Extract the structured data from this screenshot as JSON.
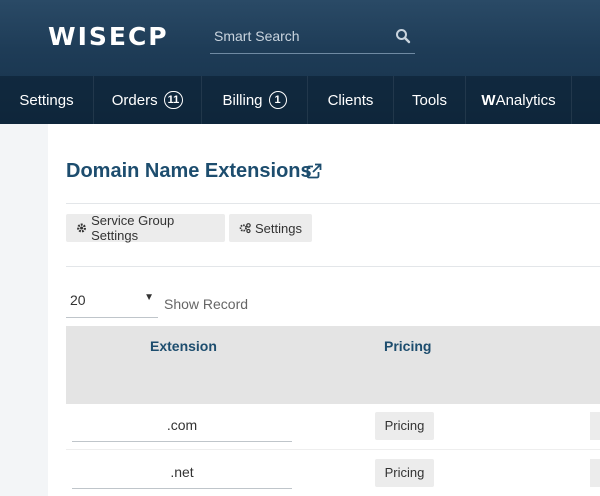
{
  "header": {
    "logo": "WISECP",
    "search": {
      "placeholder": "Smart Search",
      "value": ""
    },
    "nav": [
      {
        "label": "Settings",
        "badge": ""
      },
      {
        "label": "Orders",
        "badge": "11"
      },
      {
        "label": "Billing",
        "badge": "1"
      },
      {
        "label": "Clients",
        "badge": ""
      },
      {
        "label": "Tools",
        "badge": ""
      },
      {
        "label_bold": "W",
        "label": "Analytics",
        "badge": ""
      }
    ]
  },
  "page": {
    "title": "Domain Name Extensions",
    "buttons": {
      "service_group_settings": "Service Group Settings",
      "settings": "Settings"
    },
    "records": {
      "selected": "20",
      "label": "Show Record"
    }
  },
  "table": {
    "columns": [
      "Extension",
      "Pricing"
    ],
    "rows": [
      {
        "extension": ".com",
        "pricing_label": "Pricing"
      },
      {
        "extension": ".net",
        "pricing_label": "Pricing"
      }
    ]
  },
  "icons": [
    "search-icon",
    "external-link-icon",
    "gear-icon",
    "gears-icon",
    "dropdown-arrow-icon"
  ],
  "colors": {
    "header": "#1e3c57",
    "title": "#1d4d6e",
    "button_bg": "#ececec"
  }
}
